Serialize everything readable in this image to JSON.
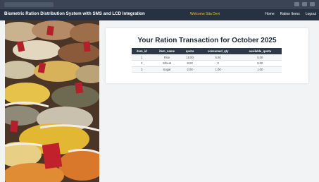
{
  "navbar": {
    "brand": "Biometric Ration Distribution System with SMS and LCD Integration",
    "welcome": "Welcome Sita Devi",
    "links": [
      "Home",
      "Ration Items",
      "Logout"
    ]
  },
  "main": {
    "title": "Your Ration Transaction for October 2025",
    "table": {
      "columns": [
        "item_id",
        "item_name",
        "quota",
        "consumed_qty",
        "available_quota"
      ],
      "rows": [
        [
          "1",
          "Rice",
          "10.00",
          "5.00",
          "5.00"
        ],
        [
          "2",
          "Wheat",
          "8.00",
          "0",
          "8.00"
        ],
        [
          "3",
          "Sugar",
          "2.00",
          "1.00",
          "1.00"
        ]
      ]
    }
  }
}
